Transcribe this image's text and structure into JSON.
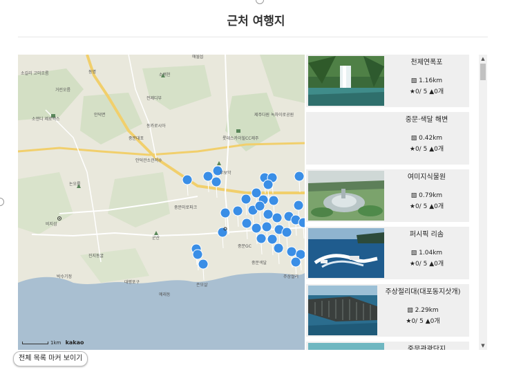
{
  "page": {
    "title": "근처 여행지"
  },
  "map": {
    "scale_label": "1km",
    "brand": "kakao",
    "labels": [
      "동명",
      "거린오름",
      "소길리 고미흐름",
      "소앤디 제로백스",
      "소백천",
      "애월읍",
      "전제디부",
      "동카로시아",
      "안덕면",
      "중문대포",
      "안덕관소관저수",
      "중문미로파크",
      "우보악",
      "롯데스카이힐CC제주",
      "제주다원 녹차이로공원",
      "논오름",
      "비지섬",
      "군산",
      "진지동굴",
      "대평포구",
      "박수기정",
      "중문GC",
      "중문색달",
      "주상절리",
      "존모살",
      "예래동"
    ],
    "marker_toggle": "전체 목록 마커 보이기"
  },
  "places": [
    {
      "name": "천제연폭포",
      "distance": "1.16km",
      "rating": "0/ 5",
      "likes": "0개",
      "image": "waterfall"
    },
    {
      "name": "중문·색달 해변",
      "distance": "0.42km",
      "rating": "0/ 5",
      "likes": "0개",
      "image": "none"
    },
    {
      "name": "여미지식물원",
      "distance": "0.79km",
      "rating": "0/ 5",
      "likes": "0개",
      "image": "botanical-garden"
    },
    {
      "name": "퍼시픽 리솜",
      "distance": "1.04km",
      "rating": "0/ 5",
      "likes": "0개",
      "image": "jet-boat"
    },
    {
      "name": "주상절리대(대포동지삿개)",
      "distance": "2.29km",
      "rating": "0/ 5",
      "likes": "0개",
      "image": "columnar-joint"
    },
    {
      "name": "중문관광단지",
      "distance": "",
      "rating": "",
      "likes": "",
      "image": "sea"
    }
  ],
  "colors": {
    "marker": "#3a8ee6",
    "sea": "#a9bfd1",
    "road": "#f5d67a",
    "card": "#efefef"
  },
  "icons": {
    "distance": "map-icon",
    "rating": "star-icon",
    "likes": "thumbs-up-icon"
  }
}
